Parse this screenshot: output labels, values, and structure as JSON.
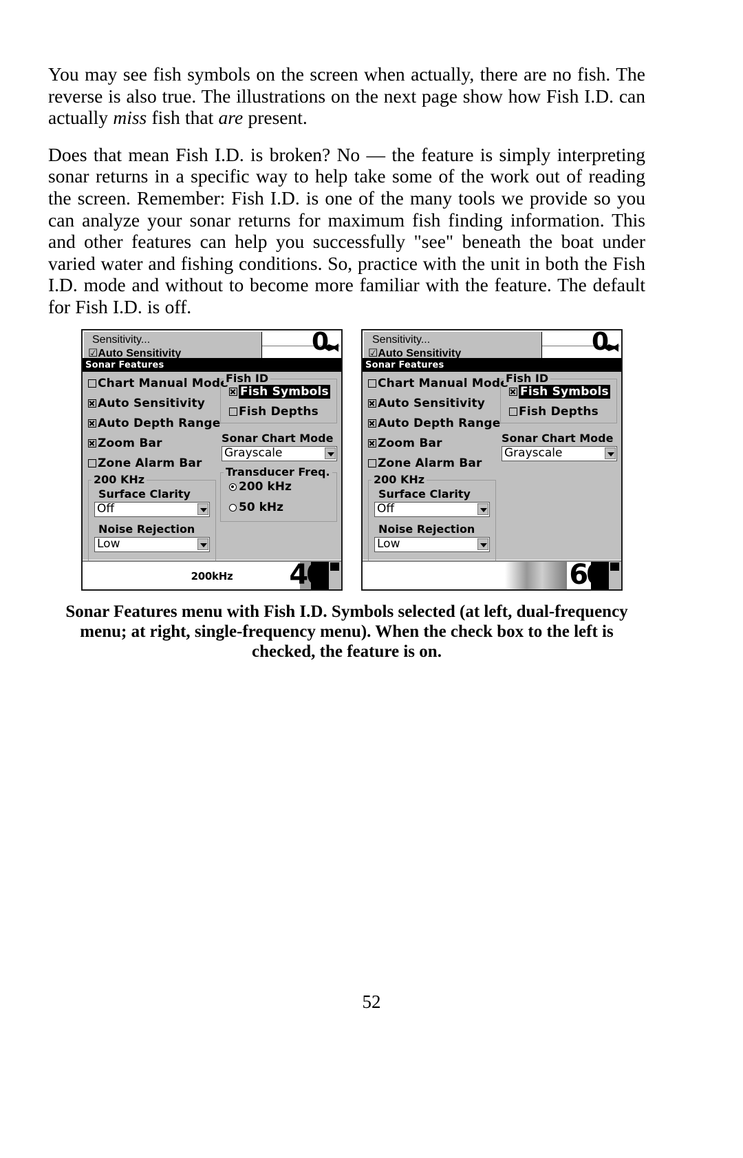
{
  "page": {
    "number": "52"
  },
  "paragraphs": {
    "p1_a": "You may see fish symbols on the screen when actually, there are no fish. The reverse is also true. The illustrations on the next page show how Fish I.D. can actually ",
    "p1_em1": "miss",
    "p1_b": " fish that ",
    "p1_em2": "are",
    "p1_c": " present.",
    "p2": "Does that mean Fish I.D. is broken? No — the feature is simply interpreting sonar returns in a specific way to help take some of the work out of reading the screen. Remember: Fish I.D. is one of the many tools we provide so you can analyze your sonar returns for maximum fish finding information. This and other features can help you successfully \"see\" beneath the boat under varied water and fishing conditions. So, practice with the unit in both the Fish I.D. mode and without to become more familiar with the feature. The default for Fish I.D. is off."
  },
  "figure": {
    "caption": "Sonar Features menu with Fish I.D. Symbols selected (at left, dual-frequency menu; at right, single-frequency menu). When the check box to the left is checked, the feature is on.",
    "screens": [
      {
        "id": "dual-frequency",
        "background_menu": {
          "item1": "Sensitivity...",
          "item2": "Auto Sensitivity"
        },
        "depth_top": "0",
        "dialog_title": "Sonar Features",
        "checkboxes": [
          {
            "label": "Chart Manual Mode",
            "checked": false,
            "selected": false
          },
          {
            "label": "Auto Sensitivity",
            "checked": true,
            "selected": false
          },
          {
            "label": "Auto Depth Range",
            "checked": true,
            "selected": false
          },
          {
            "label": "Zoom Bar",
            "checked": true,
            "selected": false
          },
          {
            "label": "Zone Alarm Bar",
            "checked": false,
            "selected": false
          }
        ],
        "group_freq": {
          "title": "200 KHz",
          "fields": [
            {
              "label": "Surface Clarity",
              "value": "Off"
            },
            {
              "label": "Noise Rejection",
              "value": "Low"
            }
          ]
        },
        "fish_id": {
          "title": "Fish ID",
          "options": [
            {
              "label": "Fish Symbols",
              "checked": true,
              "selected": true
            },
            {
              "label": "Fish Depths",
              "checked": false,
              "selected": false
            }
          ]
        },
        "sonar_chart_mode": {
          "label": "Sonar Chart Mode",
          "value": "Grayscale"
        },
        "transducer_freq": {
          "title": "Transducer Freq.",
          "options": [
            {
              "label": "200 kHz",
              "selected": true
            },
            {
              "label": "50 kHz",
              "selected": false
            }
          ]
        },
        "statusbar": {
          "freq_label": "200kHz",
          "depth": "40"
        }
      },
      {
        "id": "single-frequency",
        "background_menu": {
          "item1": "Sensitivity...",
          "item2": "Auto Sensitivity"
        },
        "depth_top": "0",
        "dialog_title": "Sonar Features",
        "checkboxes": [
          {
            "label": "Chart Manual Mode",
            "checked": false,
            "selected": false
          },
          {
            "label": "Auto Sensitivity",
            "checked": true,
            "selected": false
          },
          {
            "label": "Auto Depth Range",
            "checked": true,
            "selected": false
          },
          {
            "label": "Zoom Bar",
            "checked": true,
            "selected": false
          },
          {
            "label": "Zone Alarm Bar",
            "checked": false,
            "selected": false
          }
        ],
        "group_freq": {
          "title": "200 KHz",
          "fields": [
            {
              "label": "Surface Clarity",
              "value": "Off"
            },
            {
              "label": "Noise Rejection",
              "value": "Low"
            }
          ]
        },
        "fish_id": {
          "title": "Fish ID",
          "options": [
            {
              "label": "Fish Symbols",
              "checked": true,
              "selected": true
            },
            {
              "label": "Fish Depths",
              "checked": false,
              "selected": false
            }
          ]
        },
        "sonar_chart_mode": {
          "label": "Sonar Chart Mode",
          "value": "Grayscale"
        },
        "transducer_freq": null,
        "statusbar": {
          "freq_label": "",
          "depth": "60"
        }
      }
    ]
  }
}
